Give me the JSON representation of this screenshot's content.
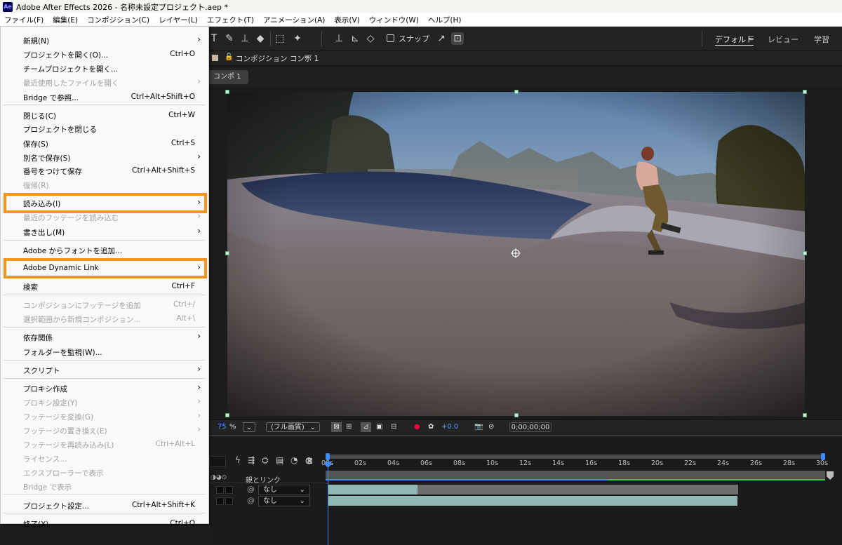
{
  "window": {
    "title": "Adobe After Effects 2026 - 名称未設定プロジェクト.aep *",
    "app_icon": "Ae"
  },
  "menubar": [
    "ファイル(F)",
    "編集(E)",
    "コンポジション(C)",
    "レイヤー(L)",
    "エフェクト(T)",
    "アニメーション(A)",
    "表示(V)",
    "ウィンドウ(W)",
    "ヘルプ(H)"
  ],
  "toolbar": {
    "snap_label": "スナップ"
  },
  "workspaces": {
    "default": "デフォルト",
    "review": "レビュー",
    "learn": "学習"
  },
  "composition": {
    "header_title": "コンポジション コンポ 1",
    "tab_label": "コンポ 1"
  },
  "viewer_footer": {
    "zoom": "75",
    "zoom_unit": "%",
    "resolution": "(フル画質)",
    "exposure": "+0.0",
    "timecode": "0;00;00;00"
  },
  "timeline": {
    "parent_header": "親とリンク",
    "ruler": [
      "00s",
      "02s",
      "04s",
      "06s",
      "08s",
      "10s",
      "12s",
      "14s",
      "16s",
      "18s",
      "20s",
      "22s",
      "24s",
      "26s",
      "28s",
      "30s"
    ],
    "layers": [
      {
        "parent": "なし"
      },
      {
        "parent": "なし"
      }
    ]
  },
  "file_menu": {
    "items": [
      {
        "label": "新規(N)",
        "submenu": true
      },
      {
        "label": "プロジェクトを開く(O)...",
        "shortcut": "Ctrl+O"
      },
      {
        "label": "チームプロジェクトを開く..."
      },
      {
        "label": "最近使用したファイルを開く",
        "submenu": true,
        "disabled": true
      },
      {
        "label": "Bridge で参照...",
        "shortcut": "Ctrl+Alt+Shift+O"
      },
      {
        "label": "閉じる(C)",
        "shortcut": "Ctrl+W"
      },
      {
        "label": "プロジェクトを閉じる"
      },
      {
        "label": "保存(S)",
        "shortcut": "Ctrl+S"
      },
      {
        "label": "別名で保存(S)",
        "submenu": true
      },
      {
        "label": "番号をつけて保存",
        "shortcut": "Ctrl+Alt+Shift+S"
      },
      {
        "label": "復帰(R)",
        "disabled": true
      },
      {
        "label": "読み込み(I)",
        "submenu": true,
        "highlighted": true
      },
      {
        "label": "最近のフッテージを読み込む",
        "submenu": true,
        "disabled": true
      },
      {
        "label": "書き出し(M)",
        "submenu": true
      },
      {
        "label": "Adobe からフォントを追加..."
      },
      {
        "label": "Adobe Dynamic Link",
        "submenu": true,
        "highlighted": true
      },
      {
        "label": "検索",
        "shortcut": "Ctrl+F"
      },
      {
        "label": "コンポジションにフッテージを追加",
        "shortcut": "Ctrl+/",
        "disabled": true
      },
      {
        "label": "選択範囲から新規コンポジション...",
        "shortcut": "Alt+\\",
        "disabled": true
      },
      {
        "label": "依存関係",
        "submenu": true
      },
      {
        "label": "フォルダーを監視(W)..."
      },
      {
        "label": "スクリプト",
        "submenu": true
      },
      {
        "label": "プロキシ作成",
        "submenu": true
      },
      {
        "label": "プロキシ設定(Y)",
        "submenu": true,
        "disabled": true
      },
      {
        "label": "フッテージを変換(G)",
        "submenu": true,
        "disabled": true
      },
      {
        "label": "フッテージの置き換え(E)",
        "submenu": true,
        "disabled": true
      },
      {
        "label": "フッテージを再読み込み(L)",
        "shortcut": "Ctrl+Alt+L",
        "disabled": true
      },
      {
        "label": "ライセンス...",
        "disabled": true
      },
      {
        "label": "エクスプローラーで表示",
        "disabled": true
      },
      {
        "label": "Bridge で表示",
        "disabled": true
      },
      {
        "label": "プロジェクト設定...",
        "shortcut": "Ctrl+Alt+Shift+K"
      },
      {
        "label": "終了(X)",
        "shortcut": "Ctrl+Q"
      }
    ]
  },
  "colors": {
    "highlight": "#f5951e",
    "timeline_bar": "#8fb8b4",
    "accent_blue": "#3d8bff"
  }
}
